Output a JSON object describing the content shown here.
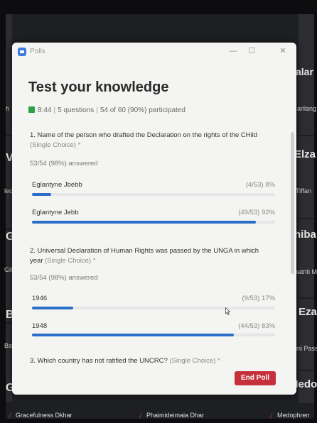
{
  "background": {
    "right_names": [
      "alar",
      "arilang",
      "Elza",
      "Tiffan",
      "hiba",
      "patriti M",
      "Eza",
      "ini Passi",
      "Medo"
    ],
    "left_letters": [
      "h",
      "V",
      "lec",
      "G",
      "Gil",
      "B",
      "Bar",
      "G"
    ],
    "bottom_names": [
      "Gracefulness Dkhar",
      "Phaimideimaia Dhar",
      "Medophren"
    ]
  },
  "window": {
    "app_title": "Polls",
    "controls": {
      "minimize": "—",
      "maximize": "☐",
      "close": "✕"
    },
    "heading": "Test your knowledge",
    "meta": {
      "time": "8:44",
      "questions": "5 questions",
      "participated": "54 of 60 (90%) participated"
    },
    "questions": [
      {
        "text": "1. Name of the person who drafted the Declaration on the rights of the CHild",
        "type": "(Single Choice) *",
        "answered": "53/54 (98%) answered",
        "options": [
          {
            "label": "Eglantyne Jbebb",
            "stat": "(4/53) 8%",
            "percent": 8
          },
          {
            "label": "Eglantyne Jebb",
            "stat": "(49/53) 92%",
            "percent": 92
          }
        ]
      },
      {
        "text": "2. Universal Declaration of Human Rights was passed by the UNGA in which year",
        "type": "(Single Choice) *",
        "answered": "53/54 (98%) answered",
        "options": [
          {
            "label": "1946",
            "stat": "(9/53) 17%",
            "percent": 17
          },
          {
            "label": "1948",
            "stat": "(44/53) 83%",
            "percent": 83
          }
        ]
      },
      {
        "text": "3. Which country has not ratified the UNCRC?",
        "type": "(Single Choice) *"
      }
    ],
    "end_poll_label": "End Poll"
  },
  "colors": {
    "bar_fill": "#2b6fc9",
    "end_button": "#c5303a",
    "meta_icon": "#2ea043"
  }
}
